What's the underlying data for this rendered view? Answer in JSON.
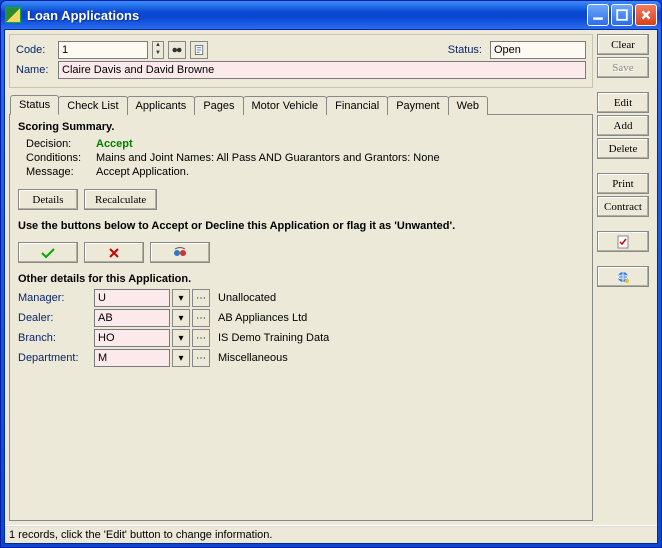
{
  "window": {
    "title": "Loan Applications"
  },
  "header": {
    "code_label": "Code:",
    "code_value": "1",
    "status_label": "Status:",
    "status_value": "Open",
    "name_label": "Name:",
    "name_value": "Claire Davis and David Browne"
  },
  "tabs": {
    "status": "Status",
    "checklist": "Check List",
    "applicants": "Applicants",
    "pages": "Pages",
    "motor": "Motor Vehicle",
    "financial": "Financial",
    "payment": "Payment",
    "web": "Web"
  },
  "scoring": {
    "heading": "Scoring Summary.",
    "decision_label": "Decision:",
    "decision_value": "Accept",
    "conditions_label": "Conditions:",
    "conditions_value": "Mains and Joint Names: All Pass AND Guarantors and Grantors: None",
    "message_label": "Message:",
    "message_value": "Accept Application."
  },
  "buttons": {
    "details": "Details",
    "recalculate": "Recalculate"
  },
  "instruction": "Use the buttons below to Accept or Decline this Application or flag it as 'Unwanted'.",
  "other": {
    "heading": "Other details for this Application.",
    "manager_label": "Manager:",
    "manager_code": "U",
    "manager_desc": "Unallocated",
    "dealer_label": "Dealer:",
    "dealer_code": "AB",
    "dealer_desc": "AB Appliances Ltd",
    "branch_label": "Branch:",
    "branch_code": "HO",
    "branch_desc": "IS Demo Training Data",
    "department_label": "Department:",
    "department_code": "M",
    "department_desc": "Miscellaneous"
  },
  "sidebar": {
    "clear": "Clear",
    "save": "Save",
    "edit": "Edit",
    "add": "Add",
    "delete": "Delete",
    "print": "Print",
    "contract": "Contract"
  },
  "statusbar": "1 records, click the 'Edit' button to change information."
}
